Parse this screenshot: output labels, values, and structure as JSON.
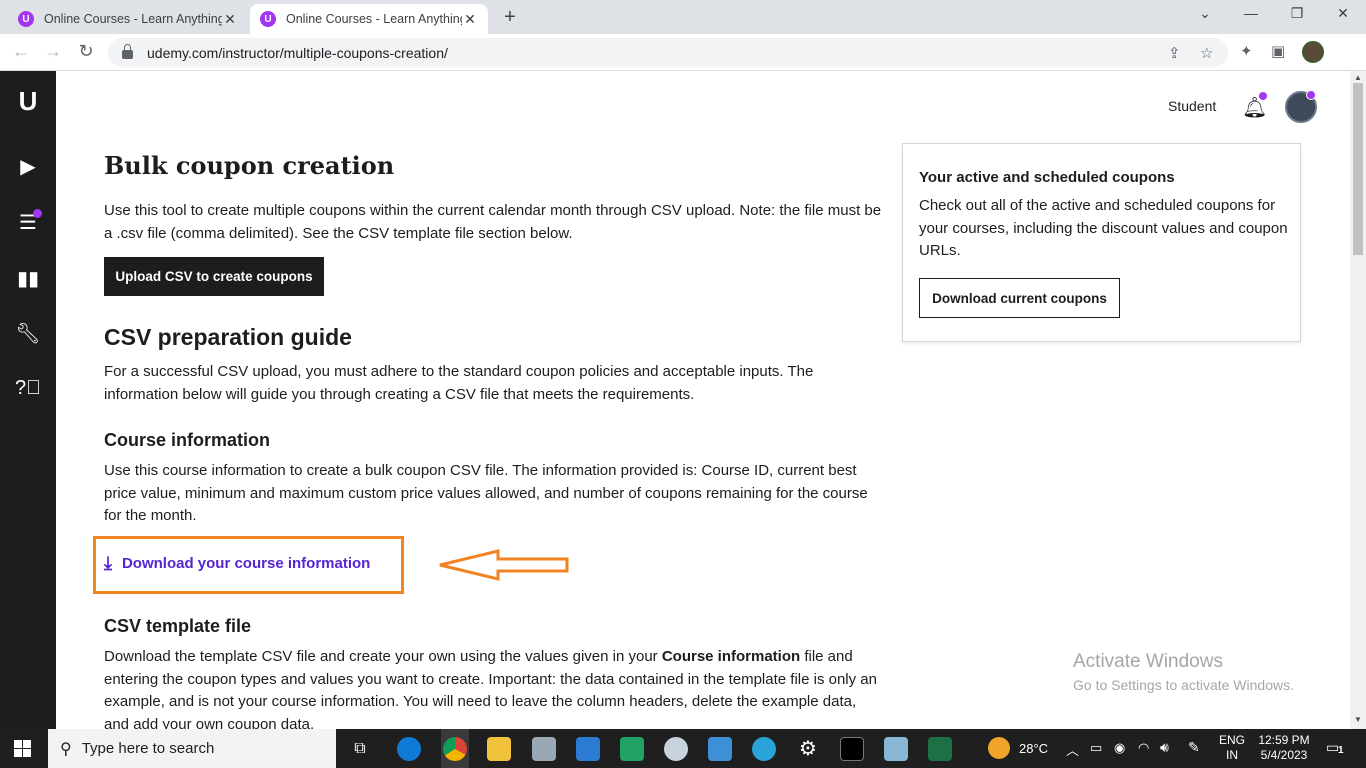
{
  "browser": {
    "tabs": [
      {
        "title": "Online Courses - Learn Anything, On Your Schedule | Udemy",
        "favicon": "udemy-favicon"
      },
      {
        "title": "Online Courses - Learn Anything, On Your Schedule | Udemy",
        "favicon": "udemy-favicon",
        "active": true
      }
    ],
    "url": "udemy.com/instructor/multiple-coupons-creation/"
  },
  "header": {
    "student_label": "Student"
  },
  "page": {
    "title": "Bulk coupon creation",
    "intro": "Use this tool to create multiple coupons within the current calendar month through CSV upload. Note: the file must be a .csv file (comma delimited). See the CSV template file section below.",
    "upload_button": "Upload CSV to create coupons",
    "guide_title": "CSV preparation guide",
    "guide_text": "For a successful CSV upload, you must adhere to the standard coupon policies and acceptable inputs. The information below will guide you through creating a CSV file that meets the requirements.",
    "course_info_title": "Course information",
    "course_info_text": "Use this course information to create a bulk coupon CSV file. The information provided is: Course ID, current best price value, minimum and maximum custom price values allowed, and number of coupons remaining for the course for the month.",
    "download_course_info": "Download your course information",
    "template_title": "CSV template file",
    "template_text_1": "Download the template CSV file and create your own using the values given in your ",
    "template_text_bold": "Course information",
    "template_text_2": " file and entering the coupon types and values you want to create. Important: the data contained in the template file is only an example, and is not your course information. You will need to leave the column headers, delete the example data, and add your own coupon data."
  },
  "coupons_card": {
    "title": "Your active and scheduled coupons",
    "text": "Check out all of the active and scheduled coupons for your courses, including the discount values and coupon URLs.",
    "button": "Download current coupons"
  },
  "watermark": {
    "line1": "Activate Windows",
    "line2": "Go to Settings to activate Windows."
  },
  "taskbar": {
    "search_placeholder": "Type here to search",
    "weather": "28°C",
    "lang_1": "ENG",
    "lang_2": "IN",
    "time": "12:59 PM",
    "date": "5/4/2023",
    "notifications": "1"
  },
  "colors": {
    "accent_purple": "#5624d0",
    "brand_purple": "#a435f0",
    "highlight_orange": "#f28322",
    "dark": "#1c1d1f"
  }
}
